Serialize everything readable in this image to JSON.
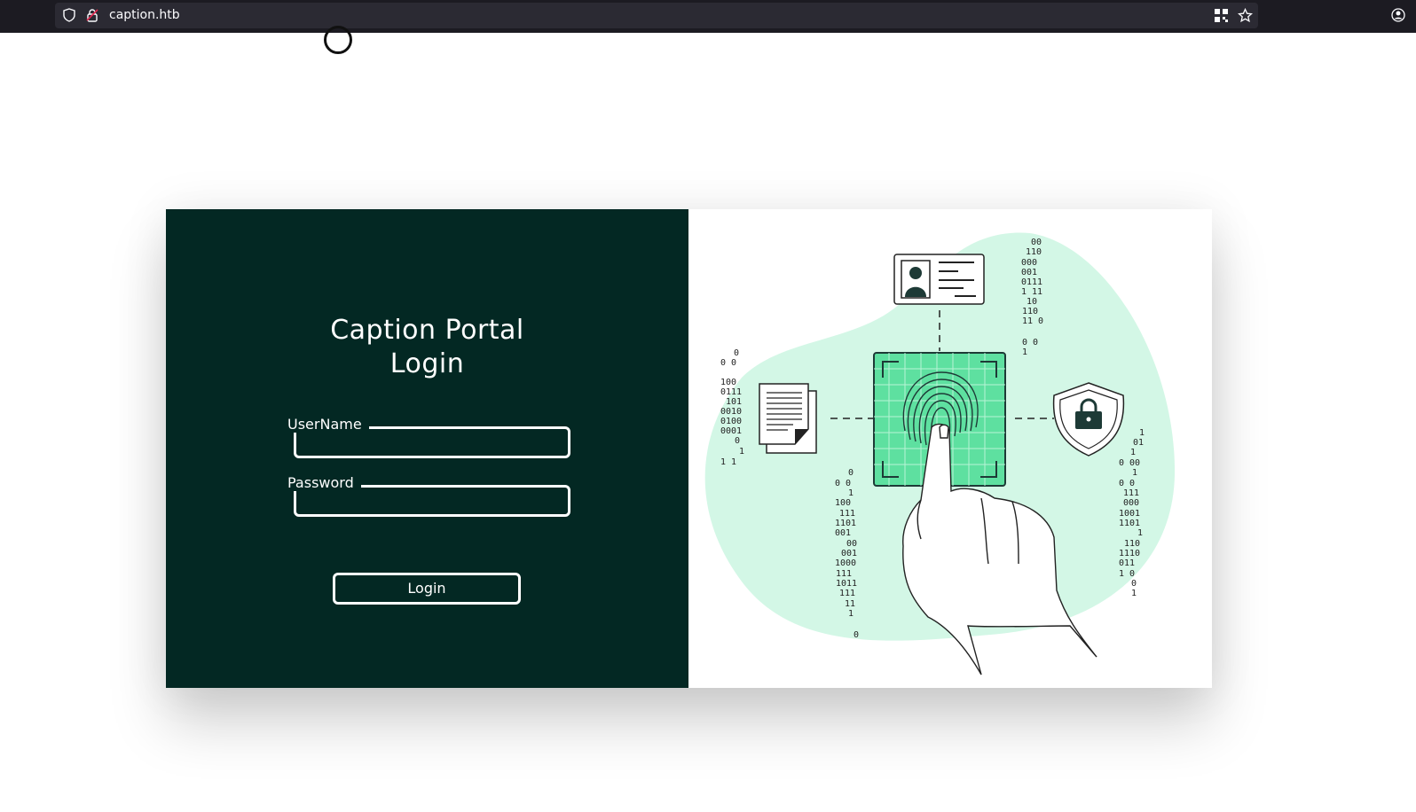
{
  "browser": {
    "url": "caption.htb",
    "icons": [
      "shield-icon",
      "lock-icon",
      "qr-code-icon",
      "star-icon",
      "account-icon"
    ]
  },
  "login": {
    "title_line1": "Caption Portal",
    "title_line2": "Login",
    "username_label": "UserName",
    "password_label": "Password",
    "button_label": "Login"
  },
  "colors": {
    "panel_bg": "#032823",
    "accent_green": "#5ee0a0",
    "blob": "#d3f7e6"
  }
}
